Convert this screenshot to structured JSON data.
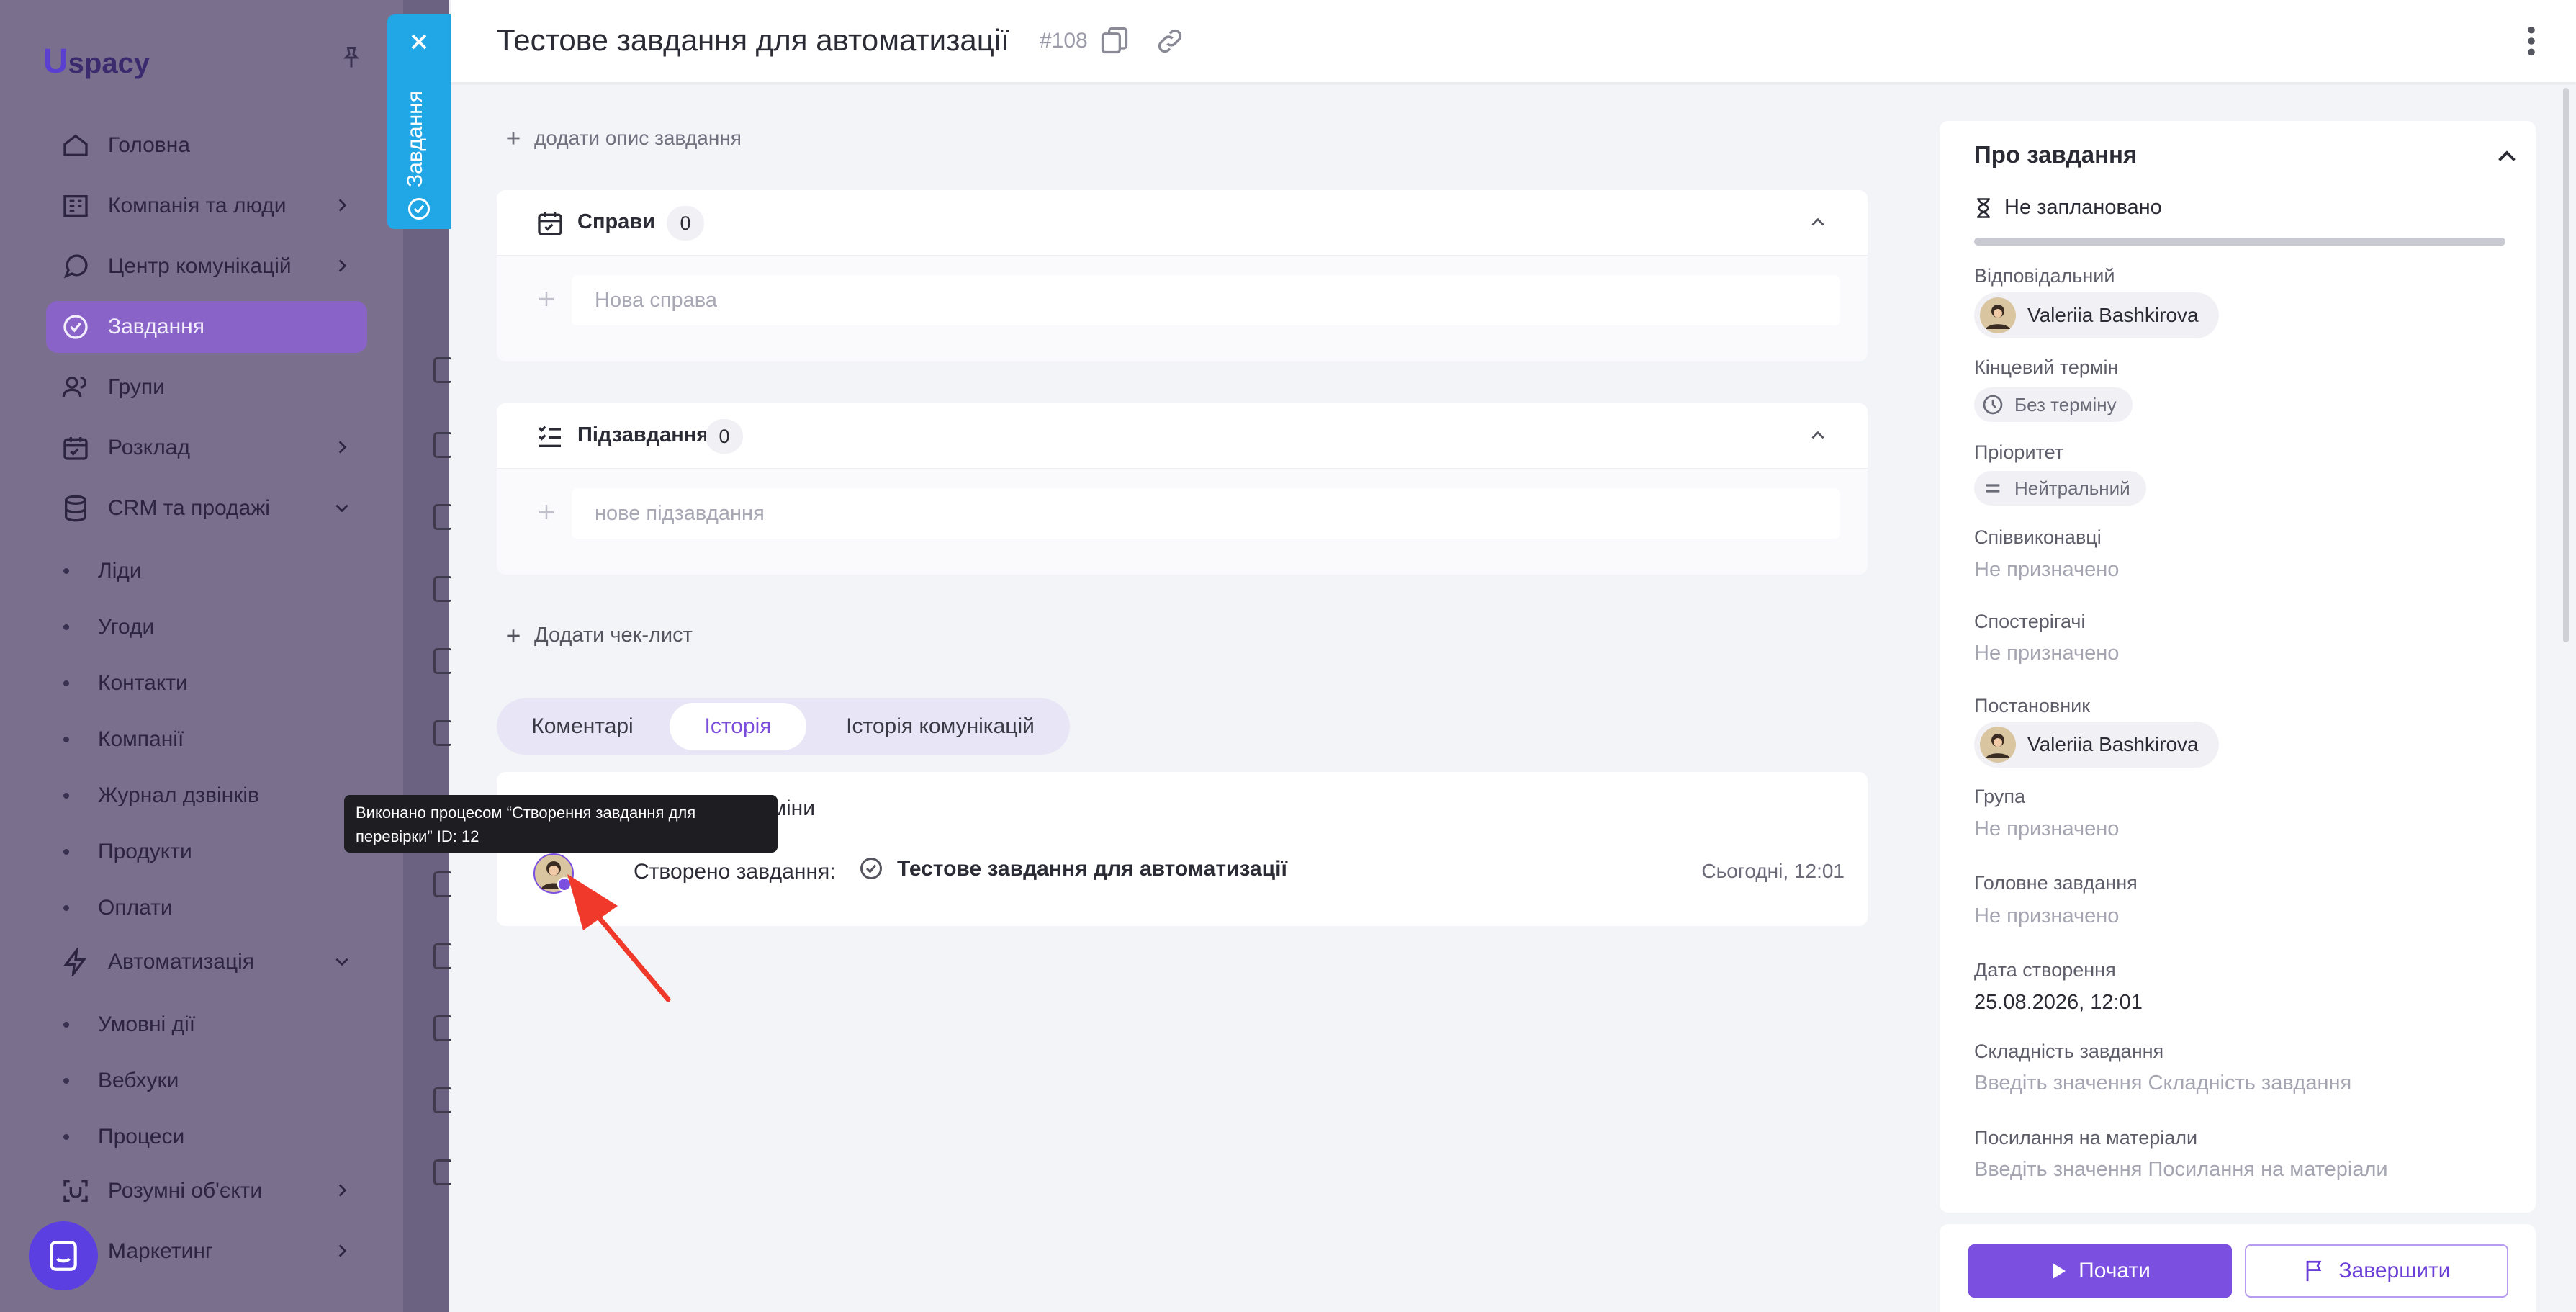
{
  "app": {
    "logo_mark": "U",
    "logo_text": "spacy",
    "nav": [
      {
        "label": "Головна",
        "icon": "home-icon"
      },
      {
        "label": "Компанія та люди",
        "icon": "company-icon"
      },
      {
        "label": "Центр комунікацій",
        "icon": "communications-icon"
      },
      {
        "label": "Завдання",
        "icon": "tasks-icon",
        "active": true
      },
      {
        "label": "Групи",
        "icon": "groups-icon"
      },
      {
        "label": "Розклад",
        "icon": "calendar-icon"
      },
      {
        "label": "CRM та продажі",
        "icon": "database-icon"
      }
    ],
    "crm_sub": [
      "Ліди",
      "Угоди",
      "Контакти",
      "Компанії",
      "Журнал дзвінків",
      "Продукти",
      "Оплати"
    ],
    "automation": {
      "label": "Автоматизація",
      "icon": "bolt-icon"
    },
    "automation_sub": [
      "Умовні дії",
      "Вебхуки",
      "Процеси"
    ],
    "smart_objects": {
      "label": "Розумні об'єкти",
      "icon": "smart-objects-icon"
    },
    "marketing": {
      "label": "Маркетинг"
    }
  },
  "side_tab": {
    "label": "Завдання"
  },
  "task": {
    "title": "Тестове завдання для автоматизації",
    "number": "#108",
    "add_description": "додати опис завдання",
    "todos": {
      "title": "Справи",
      "count": "0",
      "placeholder": "Нова справа"
    },
    "subtasks": {
      "title": "Підзавдання",
      "count": "0",
      "placeholder": "нове підзавдання"
    },
    "add_checklist": "Додати чек-лист",
    "tabs": [
      "Коментарі",
      "Історія",
      "Історія комунікацій"
    ],
    "active_tab": "Історія",
    "history": {
      "changes_fragment": "нші зміни",
      "event_label": "Створено завдання:",
      "event_task": "Тестове завдання для автоматизації",
      "event_time": "Сьогодні, 12:01"
    },
    "tooltip": "Виконано процесом “Створення завдання для перевірки” ID: 12"
  },
  "about": {
    "title": "Про завдання",
    "schedule_status": "Не заплановано",
    "responsible_label": "Відповідальний",
    "responsible": "Valeriia Bashkirova",
    "deadline_label": "Кінцевий термін",
    "deadline": "Без терміну",
    "priority_label": "Пріоритет",
    "priority": "Нейтральний",
    "coexecutors_label": "Співвиконавці",
    "coexecutors": "Не призначено",
    "observers_label": "Спостерігачі",
    "observers": "Не призначено",
    "creator_label": "Постановник",
    "creator": "Valeriia Bashkirova",
    "group_label": "Група",
    "group": "Не призначено",
    "parent_label": "Головне завдання",
    "parent": "Не призначено",
    "created_label": "Дата створення",
    "created": "25.08.2026, 12:01",
    "complexity_label": "Складність завдання",
    "complexity_placeholder": "Введіть значення Складність завдання",
    "links_label": "Посилання на матеріали",
    "links_placeholder": "Введіть значення Посилання на матеріали"
  },
  "actions": {
    "start": "Почати",
    "finish": "Завершити"
  },
  "colors": {
    "accent": "#7b4fe0",
    "side_tab": "#22a7e6",
    "active_tab_text": "#7c4ddb"
  }
}
